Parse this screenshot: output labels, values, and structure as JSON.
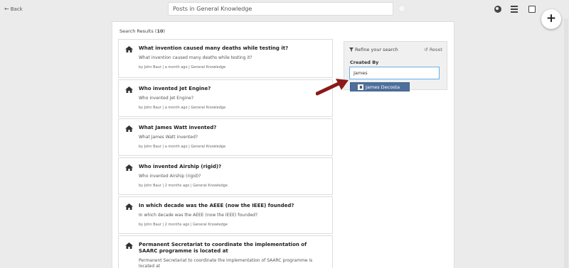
{
  "header": {
    "back_label": "Back",
    "search_value": "Posts in General Knowledge"
  },
  "results": {
    "title_prefix": "Search Results (",
    "count": "10",
    "title_suffix": ")",
    "items": [
      {
        "title": "What invention caused many deaths while testing it?",
        "question": "What invention caused many deaths while testing it?",
        "meta": "by John Baur | a month ago | General Knowledge"
      },
      {
        "title": "Who invented Jet Engine?",
        "question": "Who invented Jet Engine?",
        "meta": "by John Baur | a month ago | General Knowledge"
      },
      {
        "title": "What James Watt invented?",
        "question": "What James Watt invented?",
        "meta": "by John Baur | a month ago | General Knowledge"
      },
      {
        "title": "Who invented Airship (rigid)?",
        "question": "Who invented Airship (rigid)?",
        "meta": "by John Baur | 2 months ago | General Knowledge"
      },
      {
        "title": "In which decade was the AEEE (now the IEEE) founded?",
        "question": "In which decade was the AEEE (now the IEEE) founded?",
        "meta": "by John Baur | 2 months ago | General Knowledge"
      },
      {
        "title": "Permanent Secretariat to coordinate the implementation of SAARC programme is located at",
        "question": "Permanent Secretariat to coordinate the implementation of SAARC programme is located at",
        "meta": ""
      }
    ]
  },
  "refine": {
    "title": "Refine your search",
    "reset_label": "Reset",
    "created_by_label": "Created By",
    "created_by_value": "James",
    "suggestion": "James Decosta"
  },
  "colors": {
    "accent": "#4e6f9b",
    "arrow": "#8b1a1a"
  }
}
